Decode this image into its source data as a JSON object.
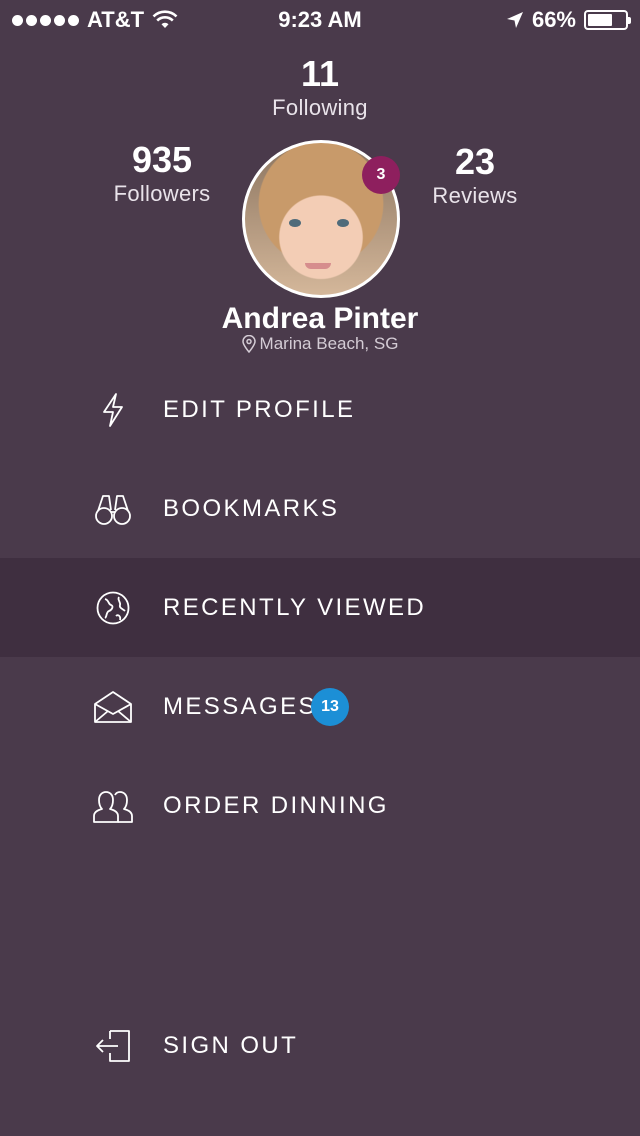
{
  "status_bar": {
    "carrier": "AT&T",
    "time": "9:23 AM",
    "battery": "66%",
    "battery_level": 0.66,
    "icons": [
      "signal-dots-icon",
      "wifi-icon",
      "location-arrow-icon",
      "battery-icon"
    ]
  },
  "profile": {
    "following_count": "11",
    "following_label": "Following",
    "followers_count": "935",
    "followers_label": "Followers",
    "reviews_count": "23",
    "reviews_label": "Reviews",
    "notification_badge": "3",
    "name": "Andrea Pinter",
    "location": "Marina Beach, SG"
  },
  "menu": {
    "items": [
      {
        "label": "EDIT PROFILE",
        "icon": "lightning-icon"
      },
      {
        "label": "BOOKMARKS",
        "icon": "binoculars-icon"
      },
      {
        "label": "RECENTLY VIEWED",
        "icon": "globe-icon",
        "active": true
      },
      {
        "label": "MESSAGES",
        "icon": "envelope-icon",
        "badge": "13"
      },
      {
        "label": "ORDER DINNING",
        "icon": "users-icon"
      }
    ],
    "sign_out": {
      "label": "SIGN OUT",
      "icon": "sign-out-icon"
    }
  },
  "colors": {
    "background": "#4a3a4b",
    "active_row": "#3f2f40",
    "avatar_badge": "#8e1f5e",
    "messages_badge": "#1c8fd6"
  }
}
